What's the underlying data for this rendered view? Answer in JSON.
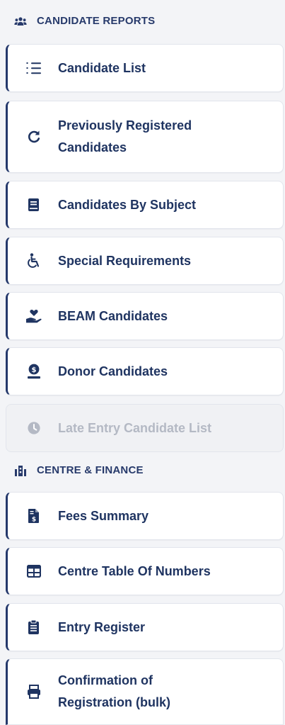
{
  "sections": [
    {
      "title": "CANDIDATE REPORTS",
      "icon": "users-icon",
      "items": [
        {
          "label": "Candidate List",
          "icon": "list-icon",
          "disabled": false
        },
        {
          "label": "Previously Registered Candidates",
          "icon": "refresh-icon",
          "disabled": false
        },
        {
          "label": "Candidates By Subject",
          "icon": "book-icon",
          "disabled": false
        },
        {
          "label": "Special Requirements",
          "icon": "wheelchair-icon",
          "disabled": false
        },
        {
          "label": "BEAM Candidates",
          "icon": "hand-heart-icon",
          "disabled": false
        },
        {
          "label": "Donor Candidates",
          "icon": "donor-icon",
          "disabled": false
        },
        {
          "label": "Late Entry Candidate List",
          "icon": "clock-icon",
          "disabled": true
        }
      ]
    },
    {
      "title": "CENTRE & FINANCE",
      "icon": "building-icon",
      "items": [
        {
          "label": "Fees Summary",
          "icon": "invoice-icon",
          "disabled": false
        },
        {
          "label": "Centre Table Of Numbers",
          "icon": "table-icon",
          "disabled": false
        },
        {
          "label": "Entry Register",
          "icon": "clipboard-icon",
          "disabled": false
        },
        {
          "label": "Confirmation of Registration (bulk)",
          "icon": "printer-icon",
          "disabled": false
        }
      ]
    }
  ],
  "colors": {
    "accent": "#24386b",
    "text": "#1f3461",
    "disabled_text": "#b4b9c4",
    "background": "#f3f4f7"
  }
}
